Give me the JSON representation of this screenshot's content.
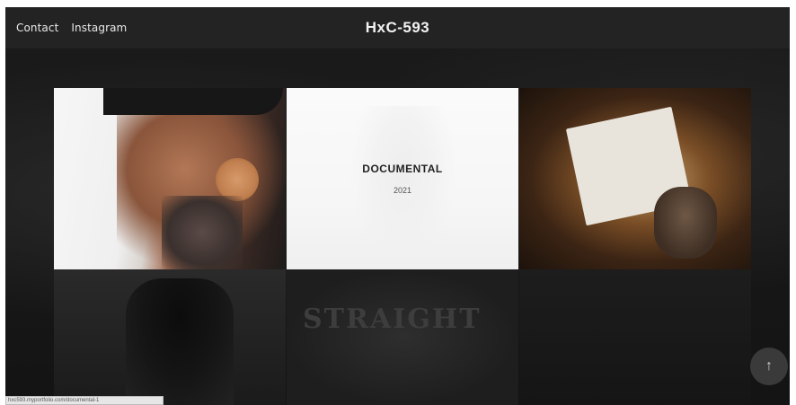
{
  "header": {
    "nav_links": [
      "Contact",
      "Instagram"
    ],
    "title": "HxC-593"
  },
  "grid": {
    "featured": {
      "title": "DOCUMENTAL",
      "year": "2021"
    },
    "tile_texts": {
      "tee_print": "STRAIGHT"
    }
  },
  "controls": {
    "to_top_icon": "↑"
  },
  "status_bar": {
    "url": "hxc593.myportfolio.com/documental-1"
  },
  "colors": {
    "header_bg": "#232323",
    "page_bg": "#121212",
    "overlay_bg": "rgba(255,255,255,0.55)",
    "button_bg": "#3a3a3a"
  },
  "icons": [
    "arrow-up-icon"
  ]
}
